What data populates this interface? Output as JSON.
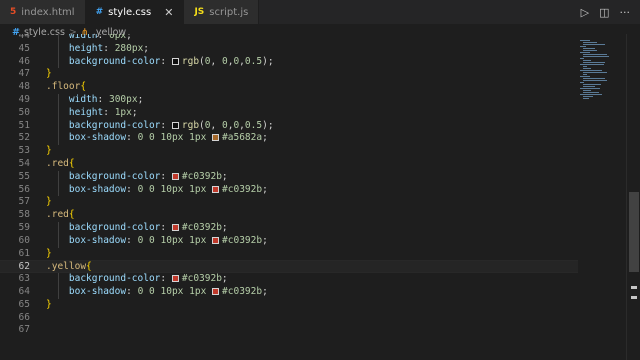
{
  "tabs": [
    {
      "icon": "5",
      "label": "index.html",
      "active": false
    },
    {
      "icon": "#",
      "label": "style.css",
      "active": true
    },
    {
      "icon": "JS",
      "label": "script.js",
      "active": false
    }
  ],
  "tab_close": "✕",
  "actions": {
    "run": "▷",
    "split": "◫",
    "more": "···"
  },
  "breadcrumb": {
    "file_icon": "#",
    "file": "style.css",
    "sep": ">",
    "symbol_icon": "⋔",
    "symbol": ".yellow"
  },
  "lines": [
    {
      "n": "44",
      "code": "    width: 0px;",
      "partial": true
    },
    {
      "n": "45",
      "code": "    height: 280px;"
    },
    {
      "n": "46",
      "code": "    background-color: □rgb(0, 0,0,0.5);"
    },
    {
      "n": "47",
      "code": "}"
    },
    {
      "n": "48",
      "code": ".floor{"
    },
    {
      "n": "49",
      "code": "    width: 300px;"
    },
    {
      "n": "50",
      "code": "    height: 1px;"
    },
    {
      "n": "51",
      "code": "    background-color: □rgb(0, 0,0,0.5);"
    },
    {
      "n": "52",
      "code": "    box-shadow: 0 0 10px 1px □#a5682a;"
    },
    {
      "n": "53",
      "code": "}"
    },
    {
      "n": "54",
      "code": ".red{"
    },
    {
      "n": "55",
      "code": "    background-color: □#c0392b;"
    },
    {
      "n": "56",
      "code": "    box-shadow: 0 0 10px 1px □#c0392b;"
    },
    {
      "n": "57",
      "code": "}"
    },
    {
      "n": "58",
      "code": ".red{"
    },
    {
      "n": "59",
      "code": "    background-color: □#c0392b;"
    },
    {
      "n": "60",
      "code": "    box-shadow: 0 0 10px 1px □#c0392b;"
    },
    {
      "n": "61",
      "code": "}"
    },
    {
      "n": "62",
      "code": ".yellow{"
    },
    {
      "n": "63",
      "code": "    background-color: □#c0392b;"
    },
    {
      "n": "64",
      "code": "    box-shadow: 0 0 10px 1px □#c0392b;"
    },
    {
      "n": "65",
      "code": "}"
    },
    {
      "n": "66",
      "code": ""
    },
    {
      "n": "67",
      "code": ""
    }
  ],
  "current_line": "62",
  "colors": {
    "background": "#1e1e1e",
    "selector": "#d7ba7d",
    "property": "#9cdcfe",
    "number": "#b5cea8",
    "function": "#dcdcaa",
    "brace": "#ffd700",
    "swatch_black": "#000000",
    "swatch_brown": "#a5682a",
    "swatch_red": "#c0392b"
  }
}
